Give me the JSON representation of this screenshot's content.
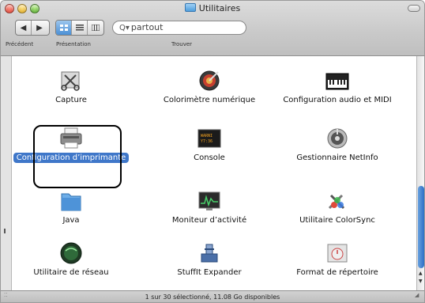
{
  "window": {
    "title": "Utilitaires"
  },
  "toolbar": {
    "back_glyph": "◀",
    "forward_glyph": "▶",
    "back_label": "Précédent",
    "view_label": "Présentation",
    "search_label": "Trouver",
    "search_value": "partout",
    "views": [
      {
        "name": "icon-view",
        "active": true
      },
      {
        "name": "list-view",
        "active": false
      },
      {
        "name": "column-view",
        "active": false
      }
    ]
  },
  "items": [
    {
      "label": "Capture",
      "icon": "capture-scissors-icon"
    },
    {
      "label": "Colorimètre numérique",
      "icon": "color-meter-icon"
    },
    {
      "label": "Configuration audio et MIDI",
      "icon": "midi-keyboard-icon"
    },
    {
      "label": "Configuration d’imprimante",
      "icon": "printer-icon",
      "selected": true
    },
    {
      "label": "Console",
      "icon": "console-icon"
    },
    {
      "label": "Gestionnaire NetInfo",
      "icon": "netinfo-icon"
    },
    {
      "label": "Java",
      "icon": "java-folder-icon"
    },
    {
      "label": "Moniteur d’activité",
      "icon": "activity-monitor-icon"
    },
    {
      "label": "Utilitaire ColorSync",
      "icon": "colorsync-icon"
    },
    {
      "label": "Utilitaire de réseau",
      "icon": "network-utility-icon"
    },
    {
      "label": "StuffIt Expander",
      "icon": "stuffit-icon"
    },
    {
      "label": "Format de répertoire",
      "icon": "directory-format-icon"
    }
  ],
  "status": {
    "text": "1 sur 30 sélectionné, 11.08 Go disponibles"
  },
  "colors": {
    "selection": "#3f77c9",
    "accent": "#4b8fd5"
  }
}
